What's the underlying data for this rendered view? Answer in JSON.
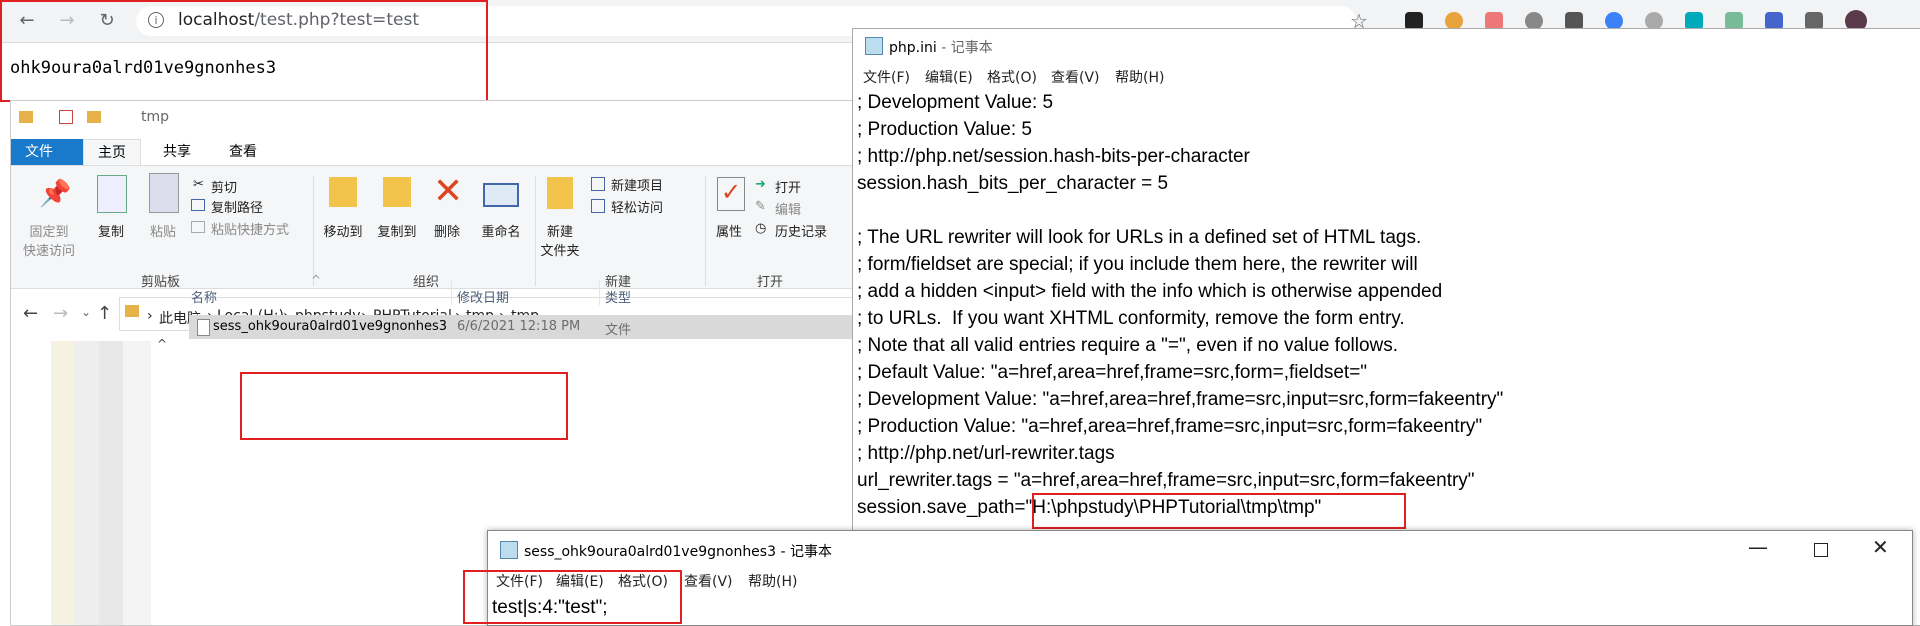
{
  "browser": {
    "url_host": "localhost",
    "url_path": "/test.php?test=test",
    "page_output": "ohk9oura0alrd01ve9gnonhes3"
  },
  "explorer": {
    "title": "tmp",
    "tabs": [
      "文件",
      "主页",
      "共享",
      "查看"
    ],
    "ribbon": {
      "pin_label": "固定到\n快速访问",
      "copy_label": "复制",
      "paste_label": "粘贴",
      "cut_label": "剪切",
      "copy_path_label": "复制路径",
      "paste_shortcut_label": "粘贴快捷方式",
      "move_to_label": "移动到",
      "copy_to_label": "复制到",
      "delete_label": "删除",
      "rename_label": "重命名",
      "new_folder_label": "新建\n文件夹",
      "new_item_label": "新建项目",
      "easy_access_label": "轻松访问",
      "properties_label": "属性",
      "open_label": "打开",
      "edit_label": "编辑",
      "history_label": "历史记录",
      "groups": [
        "剪贴板",
        "组织",
        "新建",
        "打开"
      ]
    },
    "breadcrumb": [
      "此电脑",
      "Local (H:)",
      "phpstudy",
      "PHPTutorial",
      "tmp",
      "tmp"
    ],
    "columns": [
      "名称",
      "修改日期",
      "类型"
    ],
    "files": [
      {
        "name": "sess_ohk9oura0alrd01ve9gnonhes3",
        "date": "6/6/2021 12:18 PM",
        "type": "文件"
      }
    ]
  },
  "notepad_ini": {
    "title_file": "php.ini",
    "title_app": " - 记事本",
    "menus": [
      "文件(F)",
      "编辑(E)",
      "格式(O)",
      "查看(V)",
      "帮助(H)"
    ],
    "lines": [
      "; Development Value: 5",
      "; Production Value: 5",
      "; http://php.net/session.hash-bits-per-character",
      "session.hash_bits_per_character = 5",
      "",
      "; The URL rewriter will look for URLs in a defined set of HTML tags.",
      "; form/fieldset are special; if you include them here, the rewriter will",
      "; add a hidden <input> field with the info which is otherwise appended",
      "; to URLs.  If you want XHTML conformity, remove the form entry.",
      "; Note that all valid entries require a \"=\", even if no value follows.",
      "; Default Value: \"a=href,area=href,frame=src,form=,fieldset=\"",
      "; Development Value: \"a=href,area=href,frame=src,input=src,form=fakeentry\"",
      "; Production Value: \"a=href,area=href,frame=src,input=src,form=fakeentry\"",
      "; http://php.net/url-rewriter.tags",
      "url_rewriter.tags = \"a=href,area=href,frame=src,input=src,form=fakeentry\""
    ],
    "save_path_key": "session.save_path=",
    "save_path_value": "\"H:\\phpstudy\\PHPTutorial\\tmp\\tmp\""
  },
  "notepad_sess": {
    "title": "sess_ohk9oura0alrd01ve9gnonhes3 - 记事本",
    "menus": [
      "文件(F)",
      "编辑(E)",
      "格式(O)",
      "查看(V)",
      "帮助(H)"
    ],
    "content": "test|s:4:\"test\";"
  },
  "colors": {
    "highlight": "#e02020",
    "ribbon_blue": "#1979ca"
  }
}
